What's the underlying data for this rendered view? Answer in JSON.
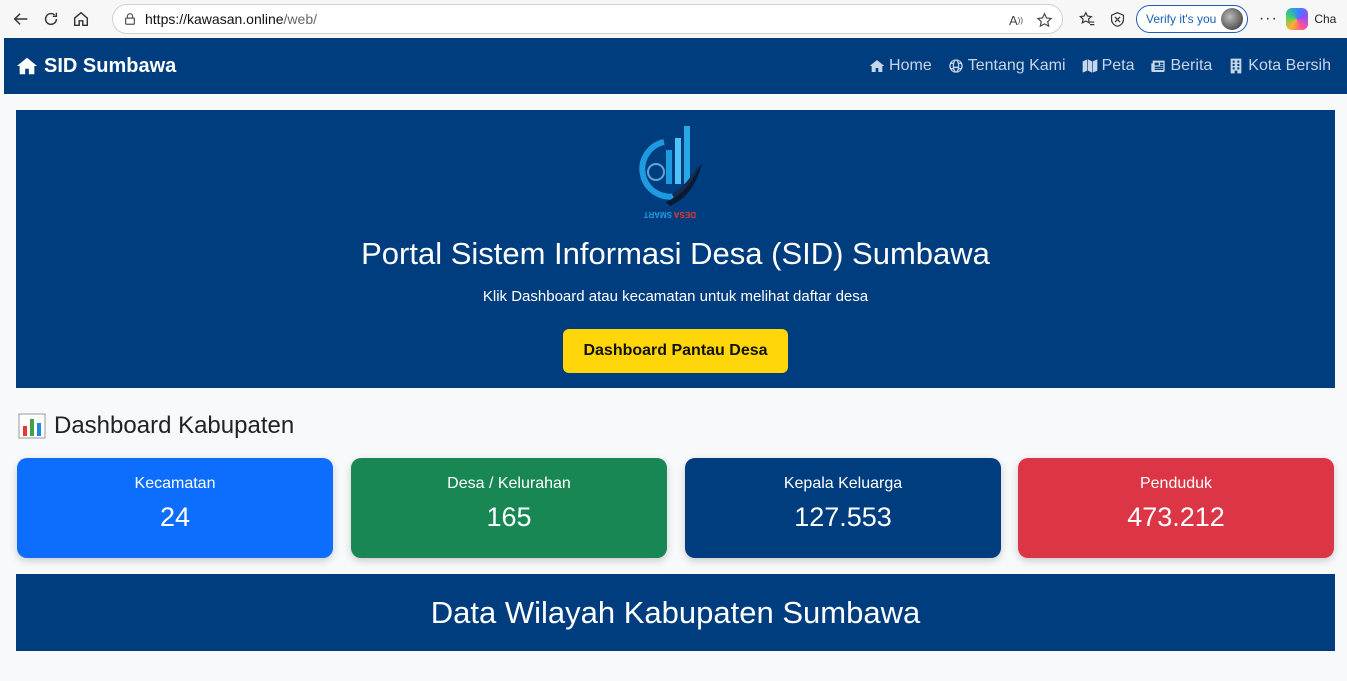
{
  "browser": {
    "url_host": "https://kawasan.online",
    "url_path": "/web/",
    "verify_label": "Verify it's you",
    "copilot_label": "Cha"
  },
  "navbar": {
    "brand": "SID Sumbawa",
    "items": [
      {
        "label": "Home",
        "icon": "home-icon"
      },
      {
        "label": "Tentang Kami",
        "icon": "globe-icon"
      },
      {
        "label": "Peta",
        "icon": "map-icon"
      },
      {
        "label": "Berita",
        "icon": "newspaper-icon"
      },
      {
        "label": "Kota Bersih",
        "icon": "building-icon"
      }
    ]
  },
  "hero": {
    "logo_text_left": "SMART",
    "logo_text_right": "DESA",
    "title": "Portal Sistem Informasi Desa (SID) Sumbawa",
    "subtitle": "Klik Dashboard atau kecamatan untuk melihat daftar desa",
    "button": "Dashboard Pantau Desa"
  },
  "dashboard": {
    "title": "Dashboard Kabupaten",
    "cards": [
      {
        "label": "Kecamatan",
        "value": "24",
        "color": "#0d6efd"
      },
      {
        "label": "Desa / Kelurahan",
        "value": "165",
        "color": "#198754"
      },
      {
        "label": "Kepala Keluarga",
        "value": "127.553",
        "color": "#003d7e"
      },
      {
        "label": "Penduduk",
        "value": "473.212",
        "color": "#dc3545"
      }
    ]
  },
  "wilayah": {
    "title": "Data Wilayah Kabupaten Sumbawa"
  }
}
